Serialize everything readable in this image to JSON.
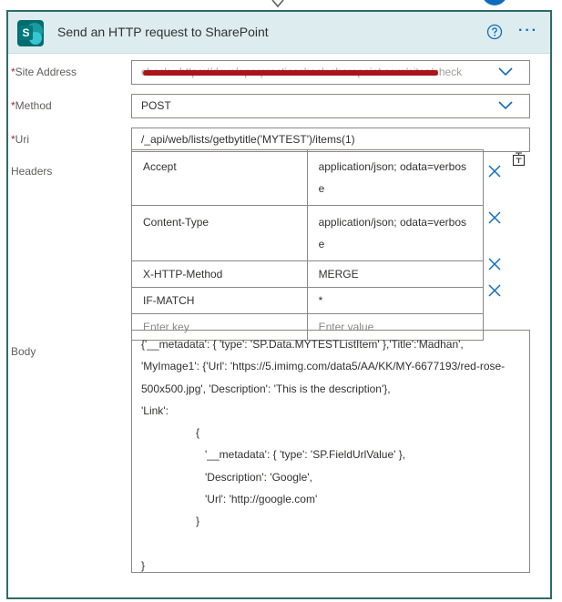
{
  "action": {
    "title": "Send an HTTP request to SharePoint",
    "logo_letter": "S",
    "brand_color": "#036c70"
  },
  "fields": {
    "site_address": {
      "label": "Site Address",
      "required": "*",
      "value": "check - https://developerpracticecheck.sharepoint.com/sites/check"
    },
    "method": {
      "label": "Method",
      "required": "*",
      "value": "POST"
    },
    "uri": {
      "label": "Uri",
      "required": "*",
      "value": "/_api/web/lists/getbytitle('MYTEST')/items(1)"
    }
  },
  "headers": {
    "label": "Headers",
    "rows": [
      {
        "key": "Accept",
        "value": "application/json; odata=verbose"
      },
      {
        "key": "Content-Type",
        "value": "application/json; odata=verbose"
      },
      {
        "key": "X-HTTP-Method",
        "value": "MERGE"
      },
      {
        "key": "IF-MATCH",
        "value": "*"
      }
    ],
    "key_placeholder": "Enter key",
    "value_placeholder": "Enter value"
  },
  "body": {
    "label": "Body",
    "lines": [
      " {'__metadata': { 'type': 'SP.Data.MYTESTListItem' },'Title':'Madhan',",
      "'MyImage1': {'Url': 'https://5.imimg.com/data5/AA/KK/MY-6677193/red-rose-",
      "500x500.jpg', 'Description': 'This is the description'},",
      "'Link':",
      "                  {",
      "                     '__metadata': { 'type': 'SP.FieldUrlValue' },",
      "                     'Description': 'Google',",
      "                     'Url': 'http://google.com'",
      "                  }",
      "",
      "}"
    ]
  }
}
